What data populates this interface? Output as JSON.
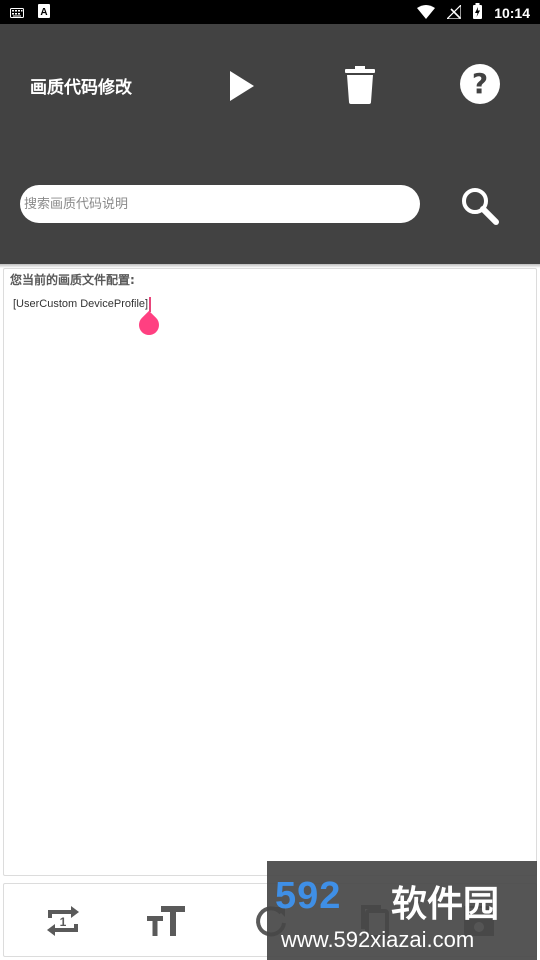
{
  "status_bar": {
    "time": "10:14",
    "left_icons": [
      "keyboard-icon",
      "a-notification-icon"
    ],
    "right_icons": [
      "wifi-icon",
      "no-signal-icon",
      "battery-charging-icon"
    ]
  },
  "header": {
    "title": "画质代码修改",
    "background": "#424242",
    "actions": [
      "play-icon",
      "trash-icon",
      "help-icon"
    ]
  },
  "search": {
    "placeholder": "搜索画质代码说明",
    "value": ""
  },
  "editor": {
    "label": "您当前的画质文件配置:",
    "content": "[UserCustom DeviceProfile]",
    "cursor_color": "#ff4081"
  },
  "toolbar": {
    "icons": [
      "repeat-one-icon",
      "text-size-icon",
      "refresh-icon",
      "copy-icon",
      "save-icon"
    ]
  },
  "watermark": {
    "brand_number": "592",
    "brand_text": "软件园",
    "url": "www.592xiazai.com",
    "accent": "#3f8fe6"
  }
}
